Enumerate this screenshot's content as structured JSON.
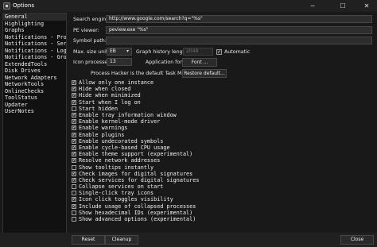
{
  "window": {
    "title": "Options"
  },
  "sidebar": {
    "items": [
      {
        "label": "General"
      },
      {
        "label": "Highlighting"
      },
      {
        "label": "Graphs"
      },
      {
        "label": "Notifications - Proce"
      },
      {
        "label": "Notifications - Servi"
      },
      {
        "label": "Notifications - Loggi"
      },
      {
        "label": "Notifications - Growl"
      },
      {
        "label": "ExtendedTools"
      },
      {
        "label": "Disk Drives"
      },
      {
        "label": "Network Adapters"
      },
      {
        "label": "NetworkTools"
      },
      {
        "label": "OnlineChecks"
      },
      {
        "label": "ToolStatus"
      },
      {
        "label": "Updater"
      },
      {
        "label": "UserNotes"
      }
    ]
  },
  "general": {
    "search_engine_label": "Search engine:",
    "search_engine_value": "http://www.google.com/search?q=\"%s\"",
    "pe_viewer_label": "PE viewer:",
    "pe_viewer_value": "peview.exe \"%s\"",
    "symbol_path_label": "Symbol path:",
    "symbol_path_value": "",
    "max_size_unit_label": "Max. size unit:",
    "max_size_unit_value": "EB",
    "graph_history_label": "Graph history length:",
    "graph_history_value": "2048",
    "automatic_label": "Automatic",
    "automatic_checked": true,
    "icon_processes_label": "Icon processes:",
    "icon_processes_value": "13",
    "application_font_label": "Application font:",
    "font_button": "Font ...",
    "default_task_manager_label": "Process Hacker is the default Task Manager:",
    "restore_default_button": "Restore default..."
  },
  "options": [
    {
      "label": "Allow only one instance",
      "checked": true
    },
    {
      "label": "Hide when closed",
      "checked": true
    },
    {
      "label": "Hide when minimized",
      "checked": true
    },
    {
      "label": "Start when I log on",
      "checked": true
    },
    {
      "label": "Start hidden",
      "checked": false
    },
    {
      "label": "Enable tray information window",
      "checked": true
    },
    {
      "label": "Enable kernel-mode driver",
      "checked": true
    },
    {
      "label": "Enable warnings",
      "checked": true
    },
    {
      "label": "Enable plugins",
      "checked": true
    },
    {
      "label": "Enable undecorated symbols",
      "checked": true
    },
    {
      "label": "Enable cycle-based CPU usage",
      "checked": true
    },
    {
      "label": "Enable theme support (experimental)",
      "checked": true
    },
    {
      "label": "Resolve network addresses",
      "checked": true
    },
    {
      "label": "Show tooltips instantly",
      "checked": false
    },
    {
      "label": "Check images for digital signatures",
      "checked": true
    },
    {
      "label": "Check services for digital signatures",
      "checked": true
    },
    {
      "label": "Collapse services on start",
      "checked": false
    },
    {
      "label": "Single-click tray icons",
      "checked": false
    },
    {
      "label": "Icon click toggles visibility",
      "checked": true
    },
    {
      "label": "Include usage of collapsed processes",
      "checked": true
    },
    {
      "label": "Show hexadecimal IDs (experimental)",
      "checked": false
    },
    {
      "label": "Show advanced options (experimental)",
      "checked": false
    }
  ],
  "buttons": {
    "reset": "Reset",
    "cleanup": "Cleanup",
    "close": "Close"
  },
  "icons": {
    "checkmark": "✓",
    "chevron": "▾",
    "minimize": "─",
    "maximize": "☐",
    "close": "✕"
  }
}
